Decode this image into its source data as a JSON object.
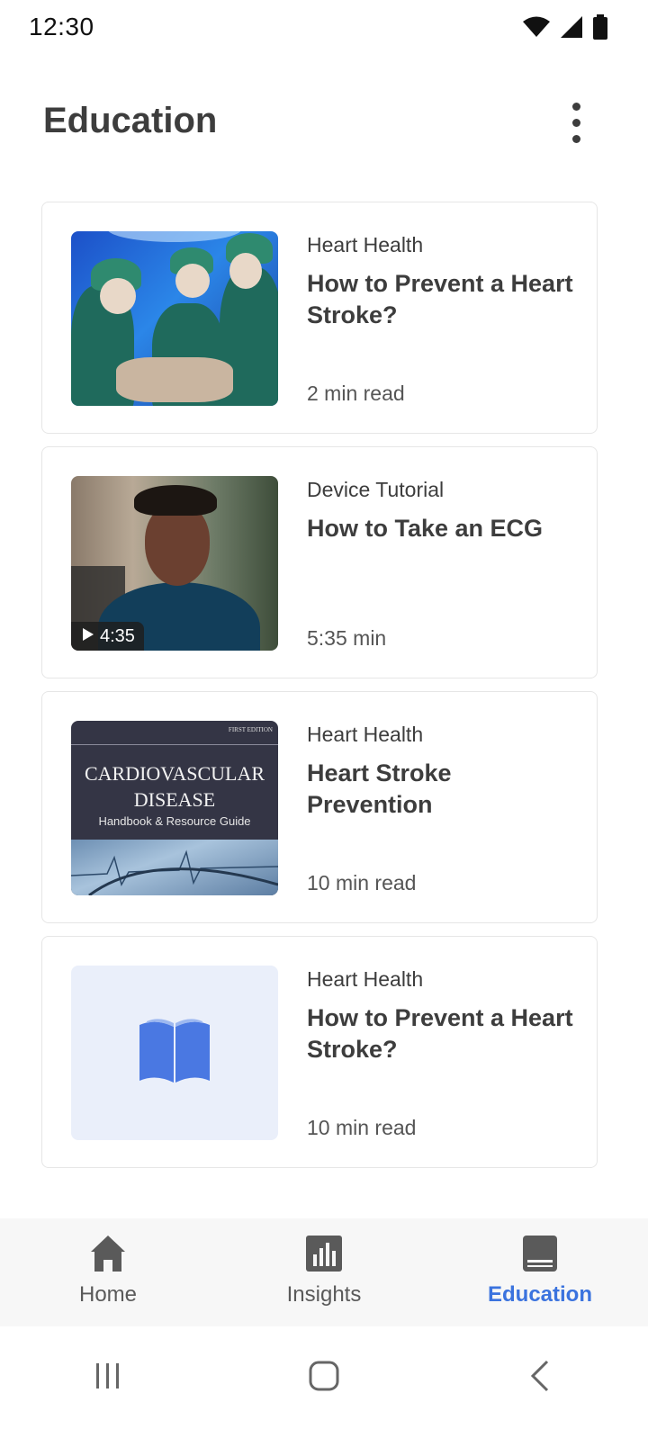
{
  "status_bar": {
    "time": "12:30",
    "icons": [
      "wifi-icon",
      "signal-icon",
      "battery-icon"
    ]
  },
  "header": {
    "title": "Education",
    "menu_icon": "more-vertical-icon"
  },
  "cards": [
    {
      "category": "Heart Health",
      "title": "How to Prevent a Heart Stroke?",
      "meta": "2 min read",
      "thumbnail": "surgery-photo"
    },
    {
      "category": "Device Tutorial",
      "title": "How to Take an ECG",
      "meta": "5:35 min",
      "thumbnail": "woman-photo",
      "video_duration": "4:35"
    },
    {
      "category": "Heart Health",
      "title": "Heart Stroke Prevention",
      "meta": "10 min read",
      "thumbnail": "book-cover",
      "cover": {
        "edition": "FIRST EDITION",
        "title_line1": "CARDIOVASCULAR",
        "title_line2": "DISEASE",
        "subtitle": "Handbook & Resource Guide"
      }
    },
    {
      "category": "Heart Health",
      "title": "How to Prevent a Heart Stroke?",
      "meta": "10 min read",
      "thumbnail": "book-icon-placeholder"
    }
  ],
  "bottom_nav": {
    "items": [
      {
        "label": "Home",
        "icon": "home-icon",
        "active": false
      },
      {
        "label": "Insights",
        "icon": "bar-chart-icon",
        "active": false
      },
      {
        "label": "Education",
        "icon": "book-icon",
        "active": true
      }
    ]
  },
  "system_nav": {
    "icons": [
      "recent-apps-icon",
      "home-button-icon",
      "back-icon"
    ]
  },
  "colors": {
    "accent": "#3b73de",
    "text_primary": "#3d3d3d",
    "nav_background": "#f7f7f7",
    "placeholder_bg": "#eaeffa",
    "book_icon": "#4a78e2"
  }
}
